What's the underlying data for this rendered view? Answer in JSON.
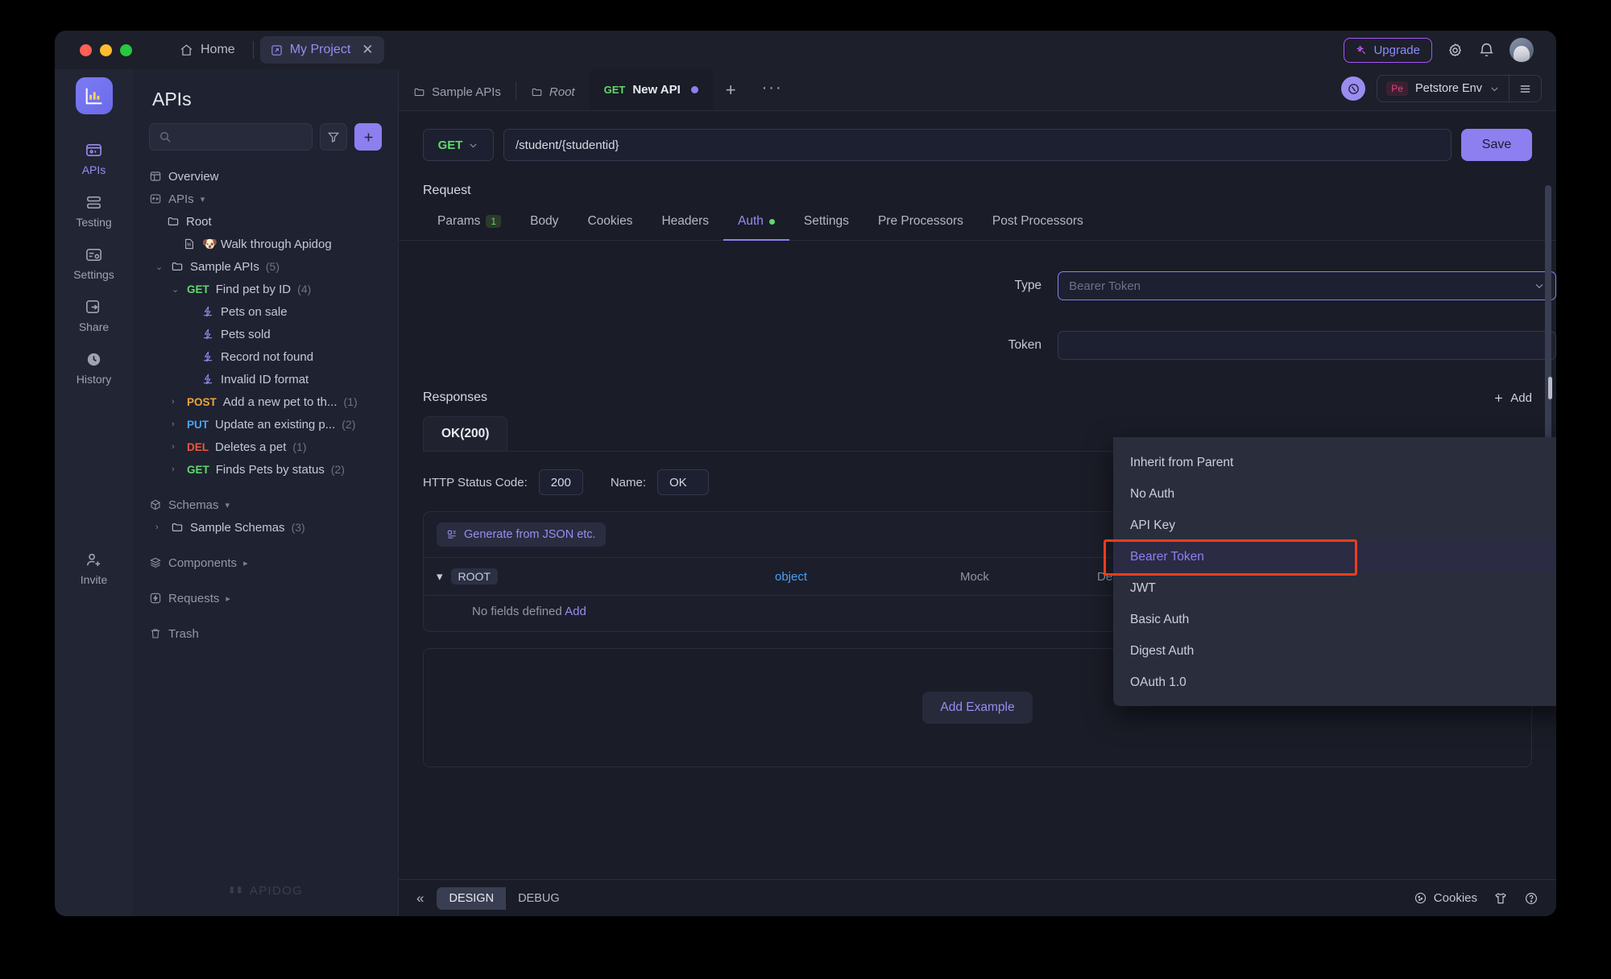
{
  "titlebar": {
    "home_tab": "Home",
    "project_tab": "My Project",
    "upgrade_label": "Upgrade",
    "icons": [
      "home-icon",
      "external-link-icon",
      "close-icon",
      "sparkle-icon",
      "gear-icon",
      "bell-icon",
      "avatar"
    ]
  },
  "rail": {
    "items": [
      {
        "label": "APIs",
        "icon": "apis-icon",
        "active": true
      },
      {
        "label": "Testing",
        "icon": "testing-icon",
        "active": false
      },
      {
        "label": "Settings",
        "icon": "settings-icon",
        "active": false
      },
      {
        "label": "Share",
        "icon": "share-icon",
        "active": false
      },
      {
        "label": "History",
        "icon": "history-icon",
        "active": false
      }
    ],
    "invite": {
      "label": "Invite",
      "icon": "invite-icon"
    }
  },
  "sidebar": {
    "title": "APIs",
    "search_placeholder": "",
    "filter_icon": "filter-icon",
    "add_icon": "plus-icon",
    "watermark": "APIDOG",
    "tree": [
      {
        "label": "Overview",
        "icon": "overview-icon",
        "indent": 0,
        "chev": ""
      },
      {
        "label": "APIs",
        "icon": "apis-node-icon",
        "indent": 0,
        "chev": "▾",
        "chevAfter": true
      },
      {
        "label": "Root",
        "icon": "folder-icon",
        "indent": 1,
        "chev": ""
      },
      {
        "label": "🐶 Walk through Apidog",
        "icon": "markdown-icon",
        "indent": 2,
        "chev": ""
      },
      {
        "label": "Sample APIs",
        "icon": "folder-icon",
        "indent": 1,
        "chev": "⌄",
        "count": "(5)"
      },
      {
        "method": "GET",
        "label": "Find pet by ID",
        "indent": 2,
        "chev": "⌄",
        "count": "(4)"
      },
      {
        "label": "Pets on sale",
        "icon": "case-icon",
        "indent": 3,
        "chev": ""
      },
      {
        "label": "Pets sold",
        "icon": "case-icon",
        "indent": 3,
        "chev": ""
      },
      {
        "label": "Record not found",
        "icon": "case-icon",
        "indent": 3,
        "chev": ""
      },
      {
        "label": "Invalid ID format",
        "icon": "case-icon",
        "indent": 3,
        "chev": ""
      },
      {
        "method": "POST",
        "label": "Add a new pet to th...",
        "indent": 2,
        "chev": "›",
        "count": "(1)"
      },
      {
        "method": "PUT",
        "label": "Update an existing p...",
        "indent": 2,
        "chev": "›",
        "count": "(2)"
      },
      {
        "method": "DEL",
        "label": "Deletes a pet",
        "indent": 2,
        "chev": "›",
        "count": "(1)"
      },
      {
        "method": "GET",
        "label": "Finds Pets by status",
        "indent": 2,
        "chev": "›",
        "count": "(2)"
      },
      {
        "label": "Schemas",
        "icon": "schemas-icon",
        "indent": 0,
        "chev": "▾",
        "chevAfter": true
      },
      {
        "label": "Sample Schemas",
        "icon": "folder-icon",
        "indent": 1,
        "chev": "›",
        "count": "(3)"
      },
      {
        "label": "Components",
        "icon": "components-icon",
        "indent": 0,
        "chev": "▸",
        "chevAfter": true
      },
      {
        "label": "Requests",
        "icon": "requests-icon",
        "indent": 0,
        "chev": "▸",
        "chevAfter": true
      },
      {
        "label": "Trash",
        "icon": "trash-icon",
        "indent": 0,
        "chev": ""
      }
    ]
  },
  "breadcrumb": {
    "items": [
      "Sample APIs",
      "Root"
    ],
    "active_tab": {
      "method": "GET",
      "name": "New API",
      "dirty": true
    },
    "plus": "+",
    "more": "···",
    "sync_icon": "sync-icon",
    "env_badge": "Pe",
    "env_name": "Petstore Env",
    "burger_icon": "menu-icon"
  },
  "url": {
    "method": "GET",
    "path": "/student/{studentid}",
    "save_label": "Save"
  },
  "request": {
    "section_label": "Request",
    "tabs": [
      {
        "label": "Params",
        "badge": "1"
      },
      {
        "label": "Body"
      },
      {
        "label": "Cookies"
      },
      {
        "label": "Headers"
      },
      {
        "label": "Auth",
        "active": true,
        "dot": true
      },
      {
        "label": "Settings"
      },
      {
        "label": "Pre Processors"
      },
      {
        "label": "Post Processors"
      }
    ],
    "type_label": "Type",
    "type_value": "Bearer Token",
    "token_label": "Token"
  },
  "dropdown": {
    "options": [
      "Inherit from Parent",
      "No Auth",
      "API Key",
      "Bearer Token",
      "JWT",
      "Basic Auth",
      "Digest Auth",
      "OAuth 1.0"
    ],
    "selected": "Bearer Token",
    "highlight_color": "#f23c19"
  },
  "responses": {
    "section_label": "Responses",
    "add_label": "Add",
    "tab_label": "OK(200)",
    "status_code_label": "HTTP Status Code:",
    "status_code_value": "200",
    "name_label": "Name:",
    "name_value": "OK",
    "generate_label": "Generate from JSON etc.",
    "columns": {
      "root": "ROOT",
      "type": "object",
      "mock": "Mock",
      "description": "Description"
    },
    "no_fields_text": "No fields defined",
    "no_fields_link": "Add",
    "add_example_label": "Add Example"
  },
  "bottombar": {
    "collapse_icon": "collapse-left-icon",
    "modes": [
      {
        "label": "DESIGN",
        "active": true
      },
      {
        "label": "DEBUG",
        "active": false
      }
    ],
    "cookies_label": "Cookies",
    "icons": [
      "cookie-icon",
      "shirt-icon",
      "help-icon"
    ]
  },
  "colors": {
    "accent": "#8d7ff0",
    "get_green": "#5fd96a",
    "post_orange": "#f0a33c",
    "put_blue": "#4aa3f0",
    "del_red": "#f0563c",
    "highlight_red": "#f23c19",
    "window_bg": "#1d1f2b"
  }
}
